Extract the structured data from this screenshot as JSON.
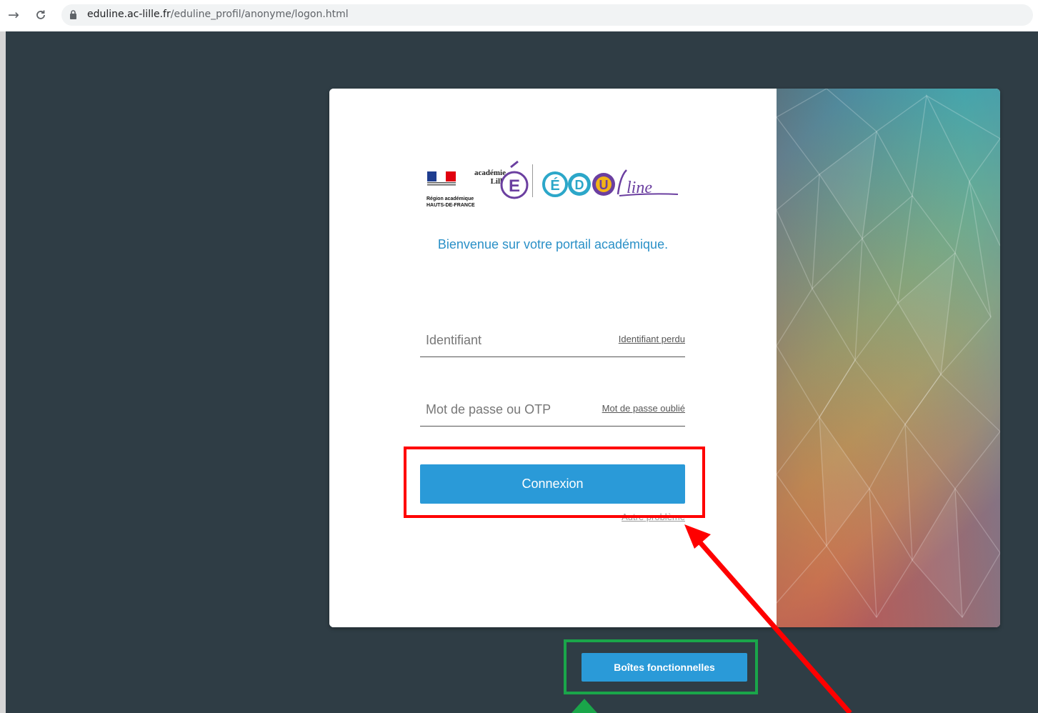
{
  "browser": {
    "back_icon": "forward-arrow-icon",
    "reload_icon": "reload-icon",
    "url_host": "eduline.ac-lille.fr",
    "url_path": "/eduline_profil/anonyme/logon.html"
  },
  "logo": {
    "region_line1": "Région académique",
    "region_line2": "HAUTS-DE-FRANCE",
    "academie": "académie",
    "academie_city": "Lille",
    "eduline_letters": [
      "É",
      "D",
      "U"
    ],
    "eduline_script": "line"
  },
  "login": {
    "welcome": "Bienvenue sur votre portail académique.",
    "id_placeholder": "Identifiant",
    "id_link": "Identifiant perdu",
    "pw_placeholder": "Mot de passe ou OTP",
    "pw_link": "Mot de passe oublié",
    "connect_label": "Connexion",
    "other_problem": "Autre problème"
  },
  "footer": {
    "boites_label": "Boîtes fonctionnelles"
  },
  "colors": {
    "page_bg": "#2f3d45",
    "accent_blue": "#2a9ad8",
    "annotation_red": "#ff0000",
    "annotation_green": "#1aa64a"
  }
}
